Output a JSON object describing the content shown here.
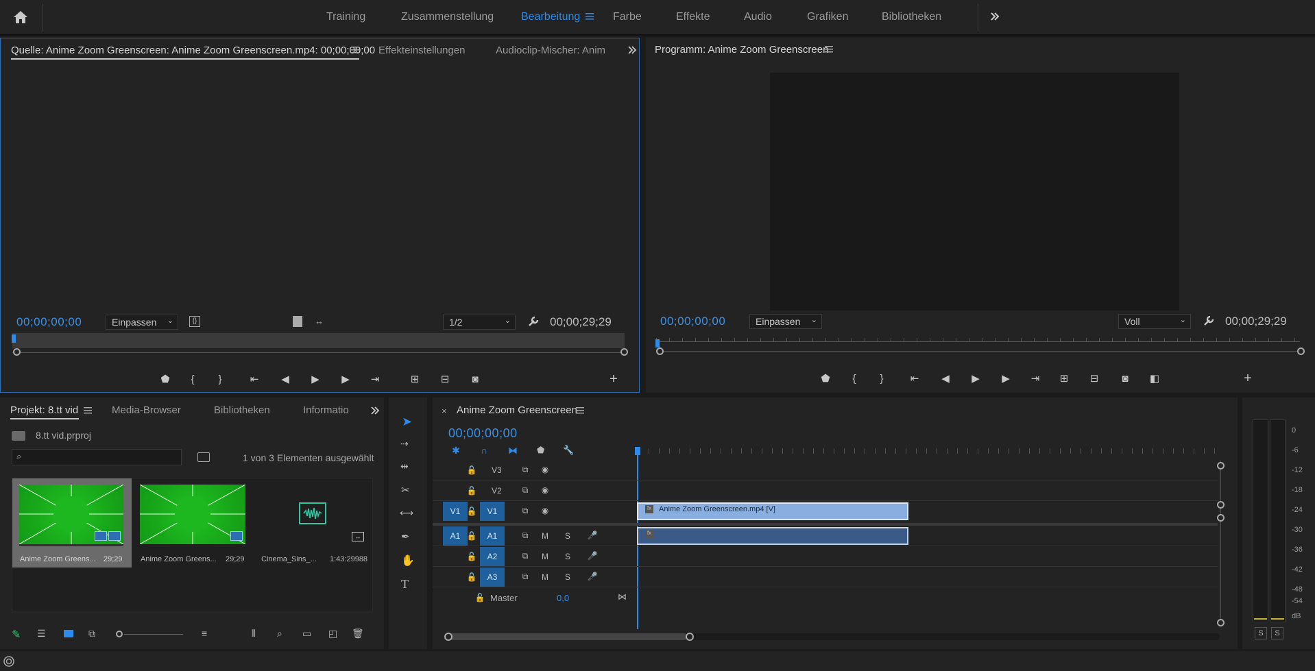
{
  "workspaces": [
    "Training",
    "Zusammenstellung",
    "Bearbeitung",
    "Farbe",
    "Effekte",
    "Audio",
    "Grafiken",
    "Bibliotheken"
  ],
  "source_panel": {
    "tabs": [
      "Quelle: Anime Zoom Greenscreen: Anime Zoom Greenscreen.mp4: 00;00;00;00",
      "Effekteinstellungen",
      "Audioclip-Mischer: Anime"
    ],
    "current_time": "00;00;00;00",
    "fit": "Einpassen",
    "resolution": "1/2",
    "duration": "00;00;29;29"
  },
  "program_panel": {
    "tab": "Programm: Anime Zoom Greenscreen",
    "current_time": "00;00;00;00",
    "fit": "Einpassen",
    "resolution": "Voll",
    "duration": "00;00;29;29"
  },
  "project_panel": {
    "tabs": [
      "Projekt: 8.tt vid",
      "Media-Browser",
      "Bibliotheken",
      "Informatio"
    ],
    "project_file": "8.tt vid.prproj",
    "search_placeholder": "",
    "selection_status": "1 von 3 Elementen ausgewählt",
    "items": [
      {
        "name": "Anime Zoom Greens...",
        "duration": "29;29",
        "kind": "video",
        "selected": true
      },
      {
        "name": "Anime Zoom Greens...",
        "duration": "29;29",
        "kind": "video",
        "selected": false
      },
      {
        "name": "Cinema_Sins_...",
        "duration": "1:43:29988",
        "kind": "audio",
        "selected": false
      }
    ]
  },
  "timeline_panel": {
    "sequence_tab": "Anime Zoom Greenscreen",
    "current_time": "00;00;00;00",
    "video_tracks": [
      {
        "label": "V3",
        "source": ""
      },
      {
        "label": "V2",
        "source": ""
      },
      {
        "label": "V1",
        "source": "V1"
      }
    ],
    "audio_tracks": [
      {
        "label": "A1",
        "source": "A1"
      },
      {
        "label": "A2",
        "source": ""
      },
      {
        "label": "A3",
        "source": ""
      }
    ],
    "master_label": "Master",
    "master_value": "0,0",
    "video_clip_label": "Anime Zoom Greenscreen.mp4 [V]",
    "fx_badge": "fx",
    "track_mute": "M",
    "track_solo": "S"
  },
  "audio_meter": {
    "scale": [
      "0",
      "-6",
      "-12",
      "-18",
      "-24",
      "-30",
      "-36",
      "-42",
      "-48",
      "-54",
      "dB"
    ],
    "solo_buttons": [
      "S",
      "S"
    ]
  },
  "colors": {
    "accent_blue": "#2d8ceb",
    "panel_bg": "#232323",
    "clip_video": "#8aaee0",
    "clip_audio": "#3a5a88",
    "thumbnail_green": "#1db81f"
  }
}
